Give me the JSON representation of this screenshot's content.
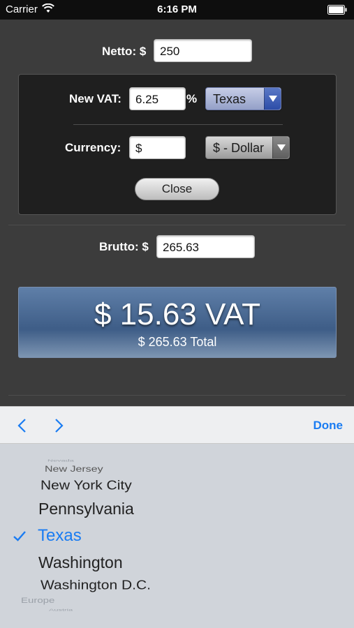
{
  "status": {
    "carrier": "Carrier",
    "time": "6:16 PM"
  },
  "form": {
    "netto_label": "Netto: $",
    "netto_value": "250",
    "vat_label": "New VAT:",
    "vat_value": "6.25",
    "vat_percent": "%",
    "state_selected": "Texas",
    "currency_label": "Currency:",
    "currency_value": "$",
    "currency_selected": "$ - Dollar",
    "close_label": "Close",
    "brutto_label": "Brutto: $",
    "brutto_value": "265.63"
  },
  "result": {
    "vat_line": "$ 15.63 VAT",
    "total_line": "$ 265.63 Total"
  },
  "toolbar": {
    "done_label": "Done"
  },
  "picker": {
    "items": [
      "Nevada",
      "New Jersey",
      "New York City",
      "Pennsylvania",
      "Texas",
      "Washington",
      "Washington D.C.",
      "Europe",
      "Austria"
    ],
    "selected": "Texas"
  },
  "colors": {
    "accent": "#1a7cf2",
    "vat_box": "#4a6a94"
  }
}
